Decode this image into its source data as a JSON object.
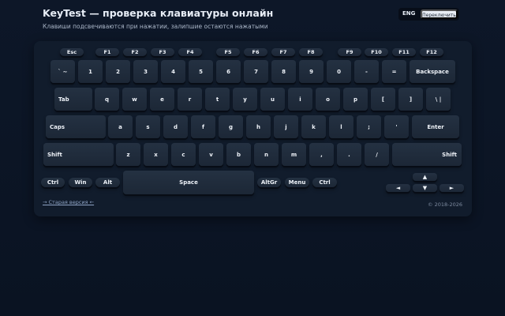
{
  "header": {
    "title": "KeyTest — проверка клавиатуры онлайн",
    "subtitle": "Клавиши подсвечиваются при нажатии, залипшие остаются нажатыми"
  },
  "language": {
    "current": "ENG",
    "switch_label": "Переключить"
  },
  "keyboard": {
    "fn_row": [
      "Esc",
      "F1",
      "F2",
      "F3",
      "F4",
      "F5",
      "F6",
      "F7",
      "F8",
      "F9",
      "F10",
      "F11",
      "F12"
    ],
    "number_row": [
      "` ~",
      "1",
      "2",
      "3",
      "4",
      "5",
      "6",
      "7",
      "8",
      "9",
      "0",
      "-",
      "=",
      "Backspace"
    ],
    "top_row": [
      "Tab",
      "q",
      "w",
      "e",
      "r",
      "t",
      "y",
      "u",
      "i",
      "o",
      "p",
      "[",
      "]",
      "\\ |"
    ],
    "home_row": [
      "Caps",
      "a",
      "s",
      "d",
      "f",
      "g",
      "h",
      "j",
      "k",
      "l",
      ";",
      "'",
      "Enter"
    ],
    "bottom_row": [
      "Shift",
      "z",
      "x",
      "c",
      "v",
      "b",
      "n",
      "m",
      ",",
      ".",
      "/",
      "Shift"
    ],
    "space_row": [
      "Ctrl",
      "Win",
      "Alt",
      "Space",
      "AltGr",
      "Menu",
      "Ctrl"
    ],
    "arrows": {
      "up": "▲",
      "left": "◄",
      "down": "▼",
      "right": "►"
    }
  },
  "footer": {
    "old_version_link": "→ Старая версия ←",
    "copyright": "© 2018-2026"
  }
}
